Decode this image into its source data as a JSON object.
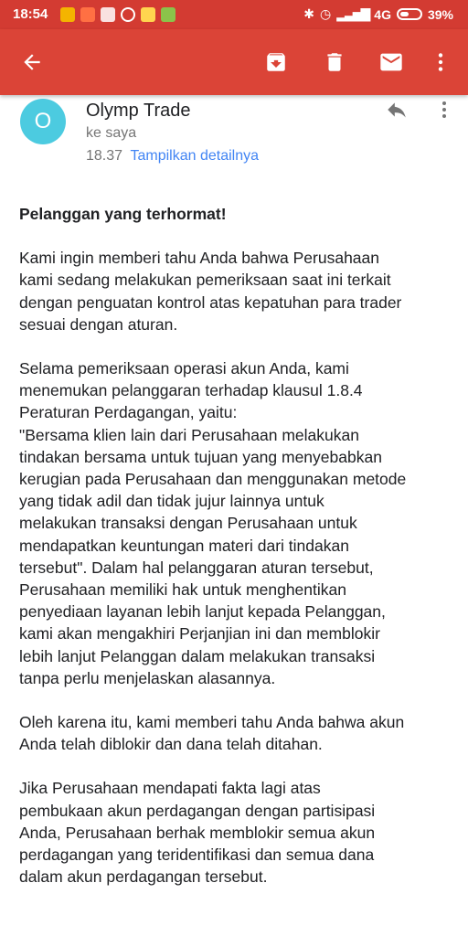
{
  "status_bar": {
    "time": "18:54",
    "network": "4G",
    "battery": "39%"
  },
  "toolbar": {
    "back_icon": "arrow-left-icon",
    "archive_icon": "archive-icon",
    "delete_icon": "trash-icon",
    "mark_unread_icon": "mail-icon",
    "more_icon": "more-vertical-icon"
  },
  "colors": {
    "status_bar": "#d33b32",
    "app_bar": "#db4437",
    "avatar": "#4ccbe0",
    "link": "#4285f4"
  },
  "email": {
    "avatar_letter": "O",
    "sender": "Olymp Trade",
    "recipient": "ke saya",
    "time": "18.37",
    "details_link": "Tampilkan detailnya",
    "greeting": "Pelanggan yang terhormat!",
    "paragraphs": [
      "Kami ingin memberi tahu Anda bahwa Perusahaan\nkami sedang melakukan pemeriksaan saat ini terkait\ndengan penguatan kontrol atas kepatuhan para trader\nsesuai dengan aturan.",
      "Selama pemeriksaan operasi akun Anda, kami\nmenemukan pelanggaran terhadap klausul 1.8.4\nPeraturan Perdagangan, yaitu:\n\"Bersama klien lain dari Perusahaan melakukan\ntindakan bersama untuk tujuan yang menyebabkan\nkerugian pada Perusahaan dan menggunakan metode\nyang tidak adil dan tidak jujur lainnya untuk\nmelakukan transaksi dengan Perusahaan untuk\nmendapatkan keuntungan materi dari tindakan\ntersebut\". Dalam hal pelanggaran aturan tersebut,\nPerusahaan memiliki hak untuk menghentikan\npenyediaan layanan lebih lanjut kepada Pelanggan,\nkami akan mengakhiri Perjanjian ini dan memblokir\nlebih lanjut Pelanggan dalam melakukan transaksi\ntanpa perlu menjelaskan alasannya.",
      "Oleh karena itu, kami memberi tahu Anda bahwa akun\nAnda telah diblokir dan dana telah ditahan.",
      "Jika Perusahaan mendapati fakta lagi atas\npembukaan akun perdagangan dengan partisipasi\nAnda, Perusahaan berhak memblokir semua akun\nperdagangan yang teridentifikasi dan semua dana\ndalam akun perdagangan tersebut."
    ]
  }
}
